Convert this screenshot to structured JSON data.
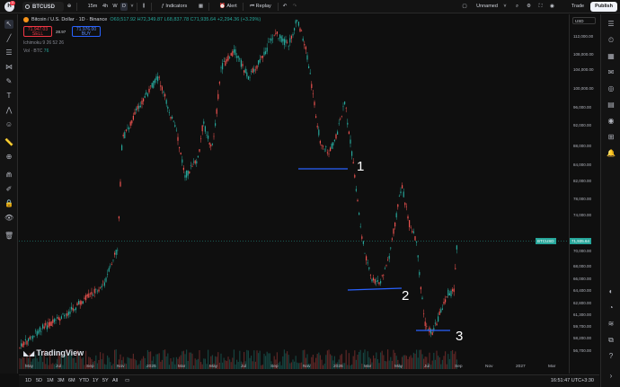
{
  "header": {
    "logo_letter": "H",
    "notification_count": "11",
    "symbol": "BTCUSD",
    "intervals": [
      "15m",
      "4h",
      "W",
      "D"
    ],
    "active_interval": "D",
    "indicators_label": "Indicators",
    "alert_label": "Alert",
    "replay_label": "Replay",
    "layout_name": "Unnamed",
    "trade_label": "Trade",
    "publish_label": "Publish"
  },
  "legend": {
    "title": "Bitcoin / U.S. Dollar · 1D · Binance",
    "ohlc": "O69,517.92 H72,349.87 L68,837.78 C71,935.64 +2,294.36 (+3.29%)",
    "sell_price": "71,947.03",
    "sell_label": "SELL",
    "spread": "28.97",
    "buy_price": "71,976.00",
    "buy_label": "BUY",
    "ichimoku": "Ichimoku 9 26 52 26",
    "volume_label": "Vol · BTC",
    "volume_value": "76"
  },
  "price_axis": {
    "currency": "USD",
    "ticks": [
      "112,000.00",
      "108,000.00",
      "104,000.00",
      "100,000.00",
      "96,000.00",
      "92,000.00",
      "88,000.00",
      "84,000.00",
      "82,000.00",
      "78,000.00",
      "74,000.00",
      "70,000.00",
      "68,000.00",
      "66,000.00",
      "64,400.00",
      "62,800.00",
      "61,300.00",
      "59,700.00",
      "58,200.00",
      "56,700.00"
    ],
    "current_price": "71,935.64",
    "current_symbol": "BTCUSD"
  },
  "time_axis": {
    "ticks": [
      "May",
      "Jul",
      "Sep",
      "Nov",
      "2025",
      "Mar",
      "May",
      "Jul",
      "Sep",
      "Nov",
      "2026",
      "Mar",
      "May",
      "Jul",
      "Sep",
      "Nov",
      "2027",
      "Mar"
    ]
  },
  "annotations": {
    "labels": [
      "1",
      "2",
      "3"
    ],
    "line_color": "#2962ff"
  },
  "bottom_bar": {
    "ranges": [
      "1D",
      "5D",
      "1M",
      "3M",
      "6M",
      "YTD",
      "1Y",
      "5Y",
      "All"
    ],
    "clock": "16:51:47 UTC+3:30"
  },
  "watermark": "TradingView",
  "colors": {
    "up": "#26a69a",
    "down": "#ef5350",
    "accent": "#2962ff"
  }
}
